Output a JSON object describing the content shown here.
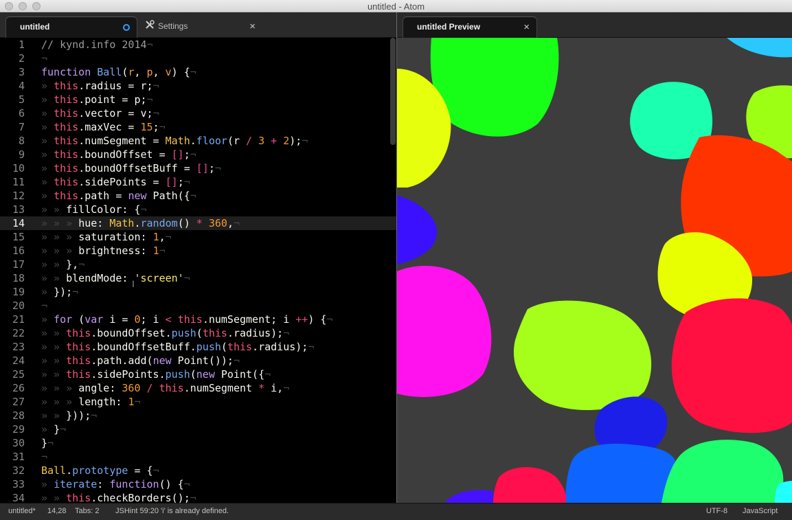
{
  "window": {
    "title": "untitled - Atom"
  },
  "left_tabs": [
    {
      "label": "untitled",
      "modified": true
    },
    {
      "label": "Settings",
      "close": "×"
    }
  ],
  "right_tabs": [
    {
      "label": "untitled Preview",
      "close": "×"
    }
  ],
  "editor": {
    "current_line": 14,
    "lines": [
      {
        "n": "1",
        "t": [
          [
            "// kynd.info 2014",
            "com"
          ],
          [
            "¬",
            "inv"
          ]
        ]
      },
      {
        "n": "2",
        "t": [
          [
            "¬",
            "inv"
          ]
        ]
      },
      {
        "n": "3",
        "t": [
          [
            "function",
            "kw"
          ],
          [
            " ",
            ""
          ],
          [
            "Ball",
            "fn"
          ],
          [
            "(",
            ""
          ],
          [
            "r",
            "var"
          ],
          [
            ", ",
            ""
          ],
          [
            "p",
            "var"
          ],
          [
            ", ",
            ""
          ],
          [
            "v",
            "var"
          ],
          [
            ") {",
            ""
          ],
          [
            "¬",
            "inv"
          ]
        ]
      },
      {
        "n": "4",
        "t": [
          [
            "» ",
            "inv"
          ],
          [
            "this",
            "th"
          ],
          [
            ".radius = r;",
            ""
          ],
          [
            "¬",
            "inv"
          ]
        ]
      },
      {
        "n": "5",
        "t": [
          [
            "» ",
            "inv"
          ],
          [
            "this",
            "th"
          ],
          [
            ".point = p;",
            ""
          ],
          [
            "¬",
            "inv"
          ]
        ]
      },
      {
        "n": "6",
        "t": [
          [
            "» ",
            "inv"
          ],
          [
            "this",
            "th"
          ],
          [
            ".vector = v;",
            ""
          ],
          [
            "¬",
            "inv"
          ]
        ]
      },
      {
        "n": "7",
        "t": [
          [
            "» ",
            "inv"
          ],
          [
            "this",
            "th"
          ],
          [
            ".maxVec = ",
            ""
          ],
          [
            "15",
            "num"
          ],
          [
            ";",
            ""
          ],
          [
            "¬",
            "inv"
          ]
        ]
      },
      {
        "n": "8",
        "t": [
          [
            "» ",
            "inv"
          ],
          [
            "this",
            "th"
          ],
          [
            ".numSegment = ",
            ""
          ],
          [
            "Math",
            "mt"
          ],
          [
            ".",
            ""
          ],
          [
            "floor",
            "fn"
          ],
          [
            "(r ",
            ""
          ],
          [
            "/",
            "op"
          ],
          [
            " ",
            ""
          ],
          [
            "3",
            "num"
          ],
          [
            " ",
            ""
          ],
          [
            "+",
            "op"
          ],
          [
            " ",
            ""
          ],
          [
            "2",
            "num"
          ],
          [
            ");",
            ""
          ],
          [
            "¬",
            "inv"
          ]
        ]
      },
      {
        "n": "9",
        "t": [
          [
            "» ",
            "inv"
          ],
          [
            "this",
            "th"
          ],
          [
            ".boundOffset = ",
            ""
          ],
          [
            "[]",
            "op"
          ],
          [
            ";",
            ""
          ],
          [
            "¬",
            "inv"
          ]
        ]
      },
      {
        "n": "10",
        "t": [
          [
            "» ",
            "inv"
          ],
          [
            "this",
            "th"
          ],
          [
            ".boundOffsetBuff = ",
            ""
          ],
          [
            "[]",
            "op"
          ],
          [
            ";",
            ""
          ],
          [
            "¬",
            "inv"
          ]
        ]
      },
      {
        "n": "11",
        "t": [
          [
            "» ",
            "inv"
          ],
          [
            "this",
            "th"
          ],
          [
            ".sidePoints = ",
            ""
          ],
          [
            "[]",
            "op"
          ],
          [
            ";",
            ""
          ],
          [
            "¬",
            "inv"
          ]
        ]
      },
      {
        "n": "12",
        "t": [
          [
            "» ",
            "inv"
          ],
          [
            "this",
            "th"
          ],
          [
            ".path = ",
            ""
          ],
          [
            "new",
            "kw"
          ],
          [
            " Path({",
            ""
          ],
          [
            "¬",
            "inv"
          ]
        ]
      },
      {
        "n": "13",
        "t": [
          [
            "» » ",
            "inv"
          ],
          [
            "fillColor: {",
            ""
          ],
          [
            "¬",
            "inv"
          ]
        ]
      },
      {
        "n": "14",
        "t": [
          [
            "» » » ",
            "inv"
          ],
          [
            "hue: ",
            ""
          ],
          [
            "Math",
            "mt"
          ],
          [
            ".",
            ""
          ],
          [
            "random",
            "fn"
          ],
          [
            "() ",
            ""
          ],
          [
            "*",
            "op"
          ],
          [
            " ",
            ""
          ],
          [
            "360",
            "num"
          ],
          [
            ",",
            ""
          ],
          [
            "¬",
            "inv"
          ]
        ]
      },
      {
        "n": "15",
        "t": [
          [
            "» » » ",
            "inv"
          ],
          [
            "saturation: ",
            ""
          ],
          [
            "1",
            "num"
          ],
          [
            ",",
            ""
          ],
          [
            "¬",
            "inv"
          ]
        ]
      },
      {
        "n": "16",
        "t": [
          [
            "» » » ",
            "inv"
          ],
          [
            "brightness: ",
            ""
          ],
          [
            "1",
            "num"
          ],
          [
            "¬",
            "inv"
          ]
        ]
      },
      {
        "n": "17",
        "t": [
          [
            "» » ",
            "inv"
          ],
          [
            "},",
            ""
          ],
          [
            "¬",
            "inv"
          ]
        ]
      },
      {
        "n": "18",
        "t": [
          [
            "» » ",
            "inv"
          ],
          [
            "blendMode: ",
            ""
          ],
          [
            "'screen'",
            "str"
          ],
          [
            "¬",
            "inv"
          ]
        ]
      },
      {
        "n": "19",
        "t": [
          [
            "» ",
            "inv"
          ],
          [
            "});",
            ""
          ],
          [
            "¬",
            "inv"
          ]
        ]
      },
      {
        "n": "20",
        "t": [
          [
            "¬",
            "inv"
          ]
        ]
      },
      {
        "n": "21",
        "t": [
          [
            "» ",
            "inv"
          ],
          [
            "for",
            "kw"
          ],
          [
            " (",
            ""
          ],
          [
            "var",
            "kw"
          ],
          [
            " i = ",
            ""
          ],
          [
            "0",
            "num"
          ],
          [
            "; i ",
            ""
          ],
          [
            "<",
            "op"
          ],
          [
            " ",
            ""
          ],
          [
            "this",
            "th"
          ],
          [
            ".numSegment; i ",
            ""
          ],
          [
            "++",
            "op"
          ],
          [
            ") {",
            ""
          ],
          [
            "¬",
            "inv"
          ]
        ]
      },
      {
        "n": "22",
        "t": [
          [
            "» » ",
            "inv"
          ],
          [
            "this",
            "th"
          ],
          [
            ".boundOffset.",
            ""
          ],
          [
            "push",
            "fn"
          ],
          [
            "(",
            ""
          ],
          [
            "this",
            "th"
          ],
          [
            ".radius);",
            ""
          ],
          [
            "¬",
            "inv"
          ]
        ]
      },
      {
        "n": "23",
        "t": [
          [
            "» » ",
            "inv"
          ],
          [
            "this",
            "th"
          ],
          [
            ".boundOffsetBuff.",
            ""
          ],
          [
            "push",
            "fn"
          ],
          [
            "(",
            ""
          ],
          [
            "this",
            "th"
          ],
          [
            ".radius);",
            ""
          ],
          [
            "¬",
            "inv"
          ]
        ]
      },
      {
        "n": "24",
        "t": [
          [
            "» » ",
            "inv"
          ],
          [
            "this",
            "th"
          ],
          [
            ".path.add(",
            ""
          ],
          [
            "new",
            "kw"
          ],
          [
            " Point());",
            ""
          ],
          [
            "¬",
            "inv"
          ]
        ]
      },
      {
        "n": "25",
        "t": [
          [
            "» » ",
            "inv"
          ],
          [
            "this",
            "th"
          ],
          [
            ".sidePoints.",
            ""
          ],
          [
            "push",
            "fn"
          ],
          [
            "(",
            ""
          ],
          [
            "new",
            "kw"
          ],
          [
            " Point({",
            ""
          ],
          [
            "¬",
            "inv"
          ]
        ]
      },
      {
        "n": "26",
        "t": [
          [
            "» » » ",
            "inv"
          ],
          [
            "angle: ",
            ""
          ],
          [
            "360",
            "num"
          ],
          [
            " ",
            ""
          ],
          [
            "/",
            "op"
          ],
          [
            " ",
            ""
          ],
          [
            "this",
            "th"
          ],
          [
            ".numSegment ",
            ""
          ],
          [
            "*",
            "op"
          ],
          [
            " i,",
            ""
          ],
          [
            "¬",
            "inv"
          ]
        ]
      },
      {
        "n": "27",
        "t": [
          [
            "» » » ",
            "inv"
          ],
          [
            "length: ",
            ""
          ],
          [
            "1",
            "num"
          ],
          [
            "¬",
            "inv"
          ]
        ]
      },
      {
        "n": "28",
        "t": [
          [
            "» » ",
            "inv"
          ],
          [
            "}));",
            ""
          ],
          [
            "¬",
            "inv"
          ]
        ]
      },
      {
        "n": "29",
        "t": [
          [
            "» ",
            "inv"
          ],
          [
            "}",
            ""
          ],
          [
            "¬",
            "inv"
          ]
        ]
      },
      {
        "n": "30",
        "t": [
          [
            "}",
            ""
          ],
          [
            "¬",
            "inv"
          ]
        ]
      },
      {
        "n": "31",
        "t": [
          [
            "¬",
            "inv"
          ]
        ]
      },
      {
        "n": "32",
        "t": [
          [
            "Ball",
            "mt"
          ],
          [
            ".",
            ""
          ],
          [
            "prototype",
            "fn"
          ],
          [
            " = {",
            ""
          ],
          [
            "¬",
            "inv"
          ]
        ]
      },
      {
        "n": "33",
        "t": [
          [
            "» ",
            "inv"
          ],
          [
            "iterate",
            "fn"
          ],
          [
            ": ",
            ""
          ],
          [
            "function",
            "kw"
          ],
          [
            "() {",
            ""
          ],
          [
            "¬",
            "inv"
          ]
        ]
      },
      {
        "n": "34",
        "t": [
          [
            "» » ",
            "inv"
          ],
          [
            "this",
            "th"
          ],
          [
            ".checkBorders();",
            ""
          ],
          [
            "¬",
            "inv"
          ]
        ]
      }
    ]
  },
  "preview": {
    "background": "#3d3d3d",
    "balls": [
      {
        "color": "#17ff17"
      },
      {
        "color": "#1affb0"
      },
      {
        "color": "#2bc7ff"
      },
      {
        "color": "#9dff14"
      },
      {
        "color": "#e6ff0c"
      },
      {
        "color": "#ff3300"
      },
      {
        "color": "#3b10ff"
      },
      {
        "color": "#e7ff00"
      },
      {
        "color": "#ff12ee"
      },
      {
        "color": "#a5ff1a"
      },
      {
        "color": "#ff1040"
      },
      {
        "color": "#1c1fe8"
      },
      {
        "color": "#0d64ff"
      },
      {
        "color": "#1dff6e"
      },
      {
        "color": "#ff0f4d"
      },
      {
        "color": "#4512ff"
      },
      {
        "color": "#22ffff"
      }
    ]
  },
  "status": {
    "file": "untitled*",
    "cursor": "14,28",
    "tabs": "Tabs: 2",
    "lint": "JSHint 59:20 'i' is already defined.",
    "encoding": "UTF-8",
    "grammar": "JavaScript"
  }
}
